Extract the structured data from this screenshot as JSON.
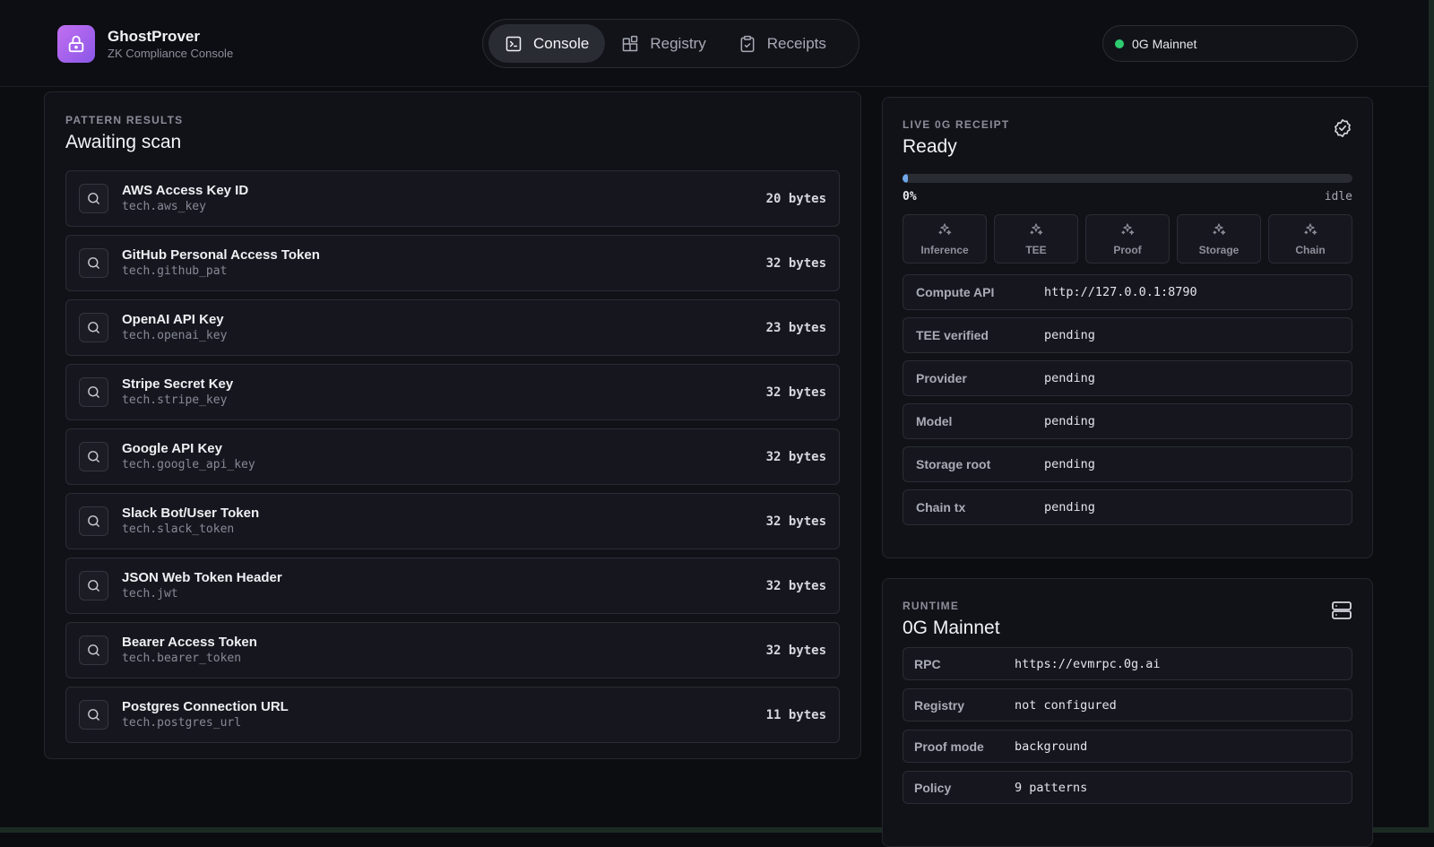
{
  "brand": {
    "name": "GhostProver",
    "subtitle": "ZK Compliance Console",
    "logo_icon": "lock-icon"
  },
  "nav": {
    "tabs": [
      {
        "label": "Console",
        "icon": "terminal-icon",
        "active": true
      },
      {
        "label": "Registry",
        "icon": "blocks-icon",
        "active": false
      },
      {
        "label": "Receipts",
        "icon": "clipboard-check-icon",
        "active": false
      }
    ]
  },
  "network": {
    "label": "0G Mainnet",
    "status_color": "#2ecc71"
  },
  "patterns": {
    "eyebrow": "PATTERN RESULTS",
    "title": "Awaiting scan",
    "items": [
      {
        "name": "AWS Access Key ID",
        "id": "tech.aws_key",
        "size": "20 bytes"
      },
      {
        "name": "GitHub Personal Access Token",
        "id": "tech.github_pat",
        "size": "32 bytes"
      },
      {
        "name": "OpenAI API Key",
        "id": "tech.openai_key",
        "size": "23 bytes"
      },
      {
        "name": "Stripe Secret Key",
        "id": "tech.stripe_key",
        "size": "32 bytes"
      },
      {
        "name": "Google API Key",
        "id": "tech.google_api_key",
        "size": "32 bytes"
      },
      {
        "name": "Slack Bot/User Token",
        "id": "tech.slack_token",
        "size": "32 bytes"
      },
      {
        "name": "JSON Web Token Header",
        "id": "tech.jwt",
        "size": "32 bytes"
      },
      {
        "name": "Bearer Access Token",
        "id": "tech.bearer_token",
        "size": "32 bytes"
      },
      {
        "name": "Postgres Connection URL",
        "id": "tech.postgres_url",
        "size": "11 bytes"
      }
    ]
  },
  "receipt": {
    "eyebrow": "LIVE 0G RECEIPT",
    "title": "Ready",
    "progress": 0,
    "progress_label": "0%",
    "progress_status": "idle",
    "progress_color": "#6ea8e8",
    "steps": [
      "Inference",
      "TEE",
      "Proof",
      "Storage",
      "Chain"
    ],
    "fields": [
      {
        "key": "Compute API",
        "value": "http://127.0.0.1:8790"
      },
      {
        "key": "TEE verified",
        "value": "pending"
      },
      {
        "key": "Provider",
        "value": "pending"
      },
      {
        "key": "Model",
        "value": "pending"
      },
      {
        "key": "Storage root",
        "value": "pending"
      },
      {
        "key": "Chain tx",
        "value": "pending"
      }
    ]
  },
  "runtime": {
    "eyebrow": "RUNTIME",
    "title": "0G Mainnet",
    "fields": [
      {
        "key": "RPC",
        "value": "https://evmrpc.0g.ai"
      },
      {
        "key": "Registry",
        "value": "not configured"
      },
      {
        "key": "Proof mode",
        "value": "background"
      },
      {
        "key": "Policy",
        "value": "9 patterns"
      }
    ]
  }
}
